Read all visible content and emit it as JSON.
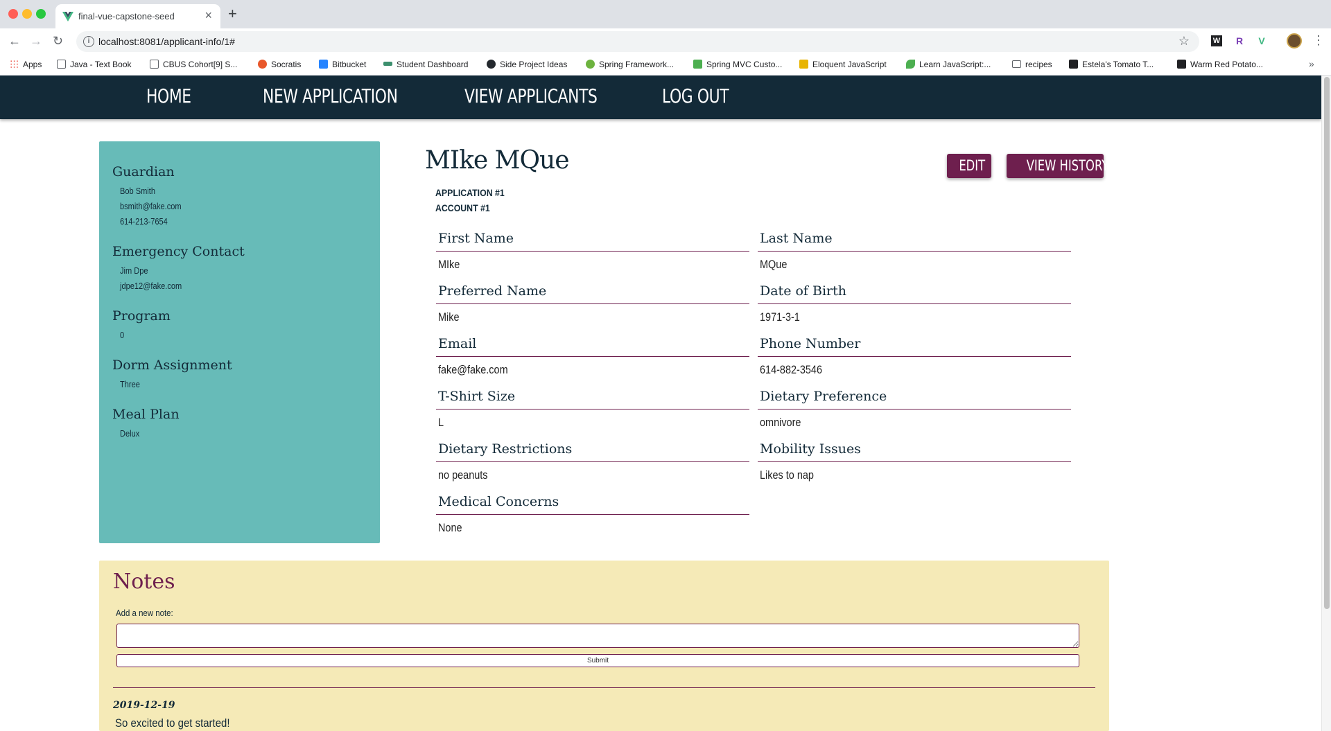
{
  "browser": {
    "tab_title": "final-vue-capstone-seed",
    "tab_close": "×",
    "new_tab": "+",
    "back": "←",
    "forward": "→",
    "reload": "↻",
    "url": "localhost:8081/applicant-info/1#",
    "star": "☆",
    "ext1": "W",
    "ext2": "R",
    "ext3": "V",
    "menu": "⋮",
    "bookmarks": [
      {
        "label": "Apps",
        "icon": "apps-grid-icon",
        "color": "#ea4335"
      },
      {
        "label": "Java - Text Book",
        "icon": "book-icon",
        "color": "#5f6368"
      },
      {
        "label": "CBUS Cohort[9] S...",
        "icon": "trello-icon",
        "color": "#5f6368"
      },
      {
        "label": "Socratis",
        "icon": "socratis-icon",
        "color": "#e8572a"
      },
      {
        "label": "Bitbucket",
        "icon": "bitbucket-icon",
        "color": "#2684ff"
      },
      {
        "label": "Student Dashboard",
        "icon": "dashboard-icon",
        "color": "#3c8f6e"
      },
      {
        "label": "Side Project Ideas",
        "icon": "github-icon",
        "color": "#24292e"
      },
      {
        "label": "Spring Framework...",
        "icon": "spring-icon",
        "color": "#6db33f"
      },
      {
        "label": "Spring MVC Custo...",
        "icon": "spring-mvc-icon",
        "color": "#4caf50"
      },
      {
        "label": "Eloquent JavaScript",
        "icon": "ejs-icon",
        "color": "#e8b400"
      },
      {
        "label": "Learn JavaScript:...",
        "icon": "learn-js-icon",
        "color": "#4caf50"
      },
      {
        "label": "recipes",
        "icon": "folder-icon",
        "color": "#5f6368"
      },
      {
        "label": "Estela's Tomato T...",
        "icon": "s-icon",
        "color": "#202124"
      },
      {
        "label": "Warm Red Potato...",
        "icon": "s-icon",
        "color": "#202124"
      }
    ],
    "bookmarks_more": "»"
  },
  "nav": {
    "items": [
      "HOME",
      "NEW APPLICATION",
      "VIEW APPLICANTS",
      "LOG OUT"
    ]
  },
  "sidebar": {
    "guardian_heading": "Guardian",
    "guardian_name": "Bob Smith",
    "guardian_email": "bsmith@fake.com",
    "guardian_phone": "614-213-7654",
    "emergency_heading": "Emergency Contact",
    "emergency_name": "Jim Dpe",
    "emergency_email": "jdpe12@fake.com",
    "program_heading": "Program",
    "program_value": "0",
    "dorm_heading": "Dorm Assignment",
    "dorm_value": "Three",
    "meal_heading": "Meal Plan",
    "meal_value": "Delux"
  },
  "main": {
    "name": "MIke MQue",
    "application": "APPLICATION #1",
    "account": "ACCOUNT #1",
    "edit_label": "EDIT",
    "history_label": "VIEW HISTORY",
    "fields": [
      {
        "label": "First Name",
        "value": "MIke"
      },
      {
        "label": "Last Name",
        "value": "MQue"
      },
      {
        "label": "Preferred Name",
        "value": "Mike"
      },
      {
        "label": "Date of Birth",
        "value": "1971-3-1"
      },
      {
        "label": "Email",
        "value": "fake@fake.com"
      },
      {
        "label": "Phone Number",
        "value": "614-882-3546"
      },
      {
        "label": "T-Shirt Size",
        "value": "L"
      },
      {
        "label": "Dietary Preference",
        "value": "omnivore"
      },
      {
        "label": "Dietary Restrictions",
        "value": "no peanuts"
      },
      {
        "label": "Mobility Issues",
        "value": "Likes to nap"
      },
      {
        "label": "Medical Concerns",
        "value": "None"
      }
    ]
  },
  "notes": {
    "title": "Notes",
    "add_label": "Add a new note:",
    "input_value": "",
    "submit_label": "Submit",
    "entries": [
      {
        "date": "2019-12-19",
        "text": "So excited to get started!"
      }
    ]
  },
  "colors": {
    "nav_bg": "#132a38",
    "accent": "#6e1f4e",
    "sidebar_bg": "#67bbb8",
    "notes_bg": "#f5eab7"
  }
}
